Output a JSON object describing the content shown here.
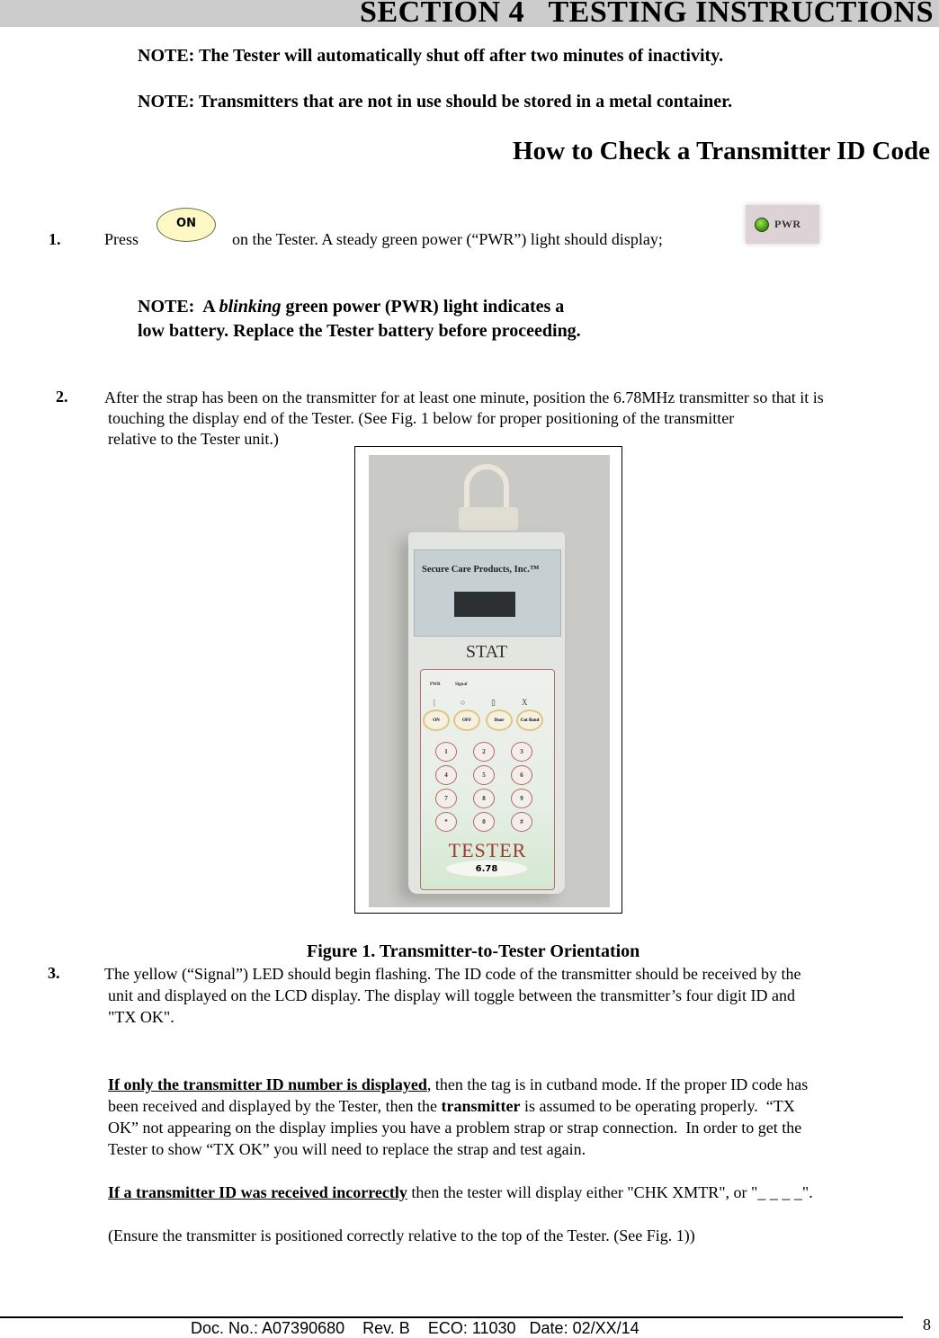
{
  "header": {
    "section_title": "SECTION 4   TESTING INSTRUCTIONS"
  },
  "notes": [
    "NOTE:  The Tester will automatically shut off after two minutes of inactivity.",
    "NOTE:  Transmitters that are not in use should be stored in a metal container."
  ],
  "subheading": "How to Check a Transmitter ID Code",
  "step1": {
    "number": "1.",
    "press": "Press",
    "button_label": "ON",
    "text": "on the Tester. A steady green power (“PWR”) light should display;",
    "indicator_label": "PWR",
    "indicator_color": "#4caf1a"
  },
  "battery_note": {
    "prefix": "NOTE:  A ",
    "italic": "blinking",
    "line1_rest": " green power (PWR) light indicates a",
    "line2": "low battery.  Replace the Tester battery before proceeding."
  },
  "step2": {
    "number": "2.",
    "line1": "After the strap has been on the transmitter for at least one minute, position the 6.78MHz transmitter so that it is",
    "line2": "touching the display end of the Tester. (See Fig. 1 below for proper positioning of the transmitter",
    "line3": "relative to the Tester unit.)"
  },
  "figure": {
    "caption": "Figure 1.  Transmitter-to-Tester Orientation",
    "photo": {
      "logo_text": "Secure Care Products, Inc.™",
      "model_label": "STAT",
      "led_labels": [
        "PWR",
        "Signal"
      ],
      "function_keys": [
        "ON",
        "OFF",
        "Door",
        "Cut Band"
      ],
      "keypad": [
        "1",
        "2",
        "3",
        "4",
        "5",
        "6",
        "7",
        "8",
        "9",
        "*",
        "0",
        "#"
      ],
      "brand": "TESTER",
      "frequency": "6.78"
    }
  },
  "step3": {
    "number": "3.",
    "line1": "The yellow (“Signal”) LED should begin flashing.  The ID code of the transmitter should be received by the",
    "line2": "unit and displayed on the LCD display.  The display will toggle between the transmitter’s four digit ID and",
    "line3": "\"TX OK\".",
    "para2_underlined": "If only the transmitter ID number is displayed",
    "para2_a": ", then the tag is in cutband mode. If the proper ID code has",
    "para2_b_pre": "been received and displayed by the Tester, then the ",
    "para2_b_bold": "transmitter",
    "para2_b_post": " is assumed to be operating properly.  “TX",
    "para2_c": "OK” not appearing on the display implies you have a problem strap or strap connection.  In order to get the",
    "para2_d": "Tester to show “TX OK” you will need to replace the strap and test again.",
    "para3_underlined": "If a transmitter ID was received incorrectly",
    "para3_rest": " then the tester will display either \"CHK XMTR\", or \"_ _ _ _\".",
    "para4": "(Ensure the transmitter is positioned correctly relative to the top of the Tester. (See Fig. 1))"
  },
  "footer": {
    "doc_info": "Doc. No.: A07390680    Rev. B    ECO: 11030   Date: 02/XX/14",
    "page_number": "8"
  }
}
